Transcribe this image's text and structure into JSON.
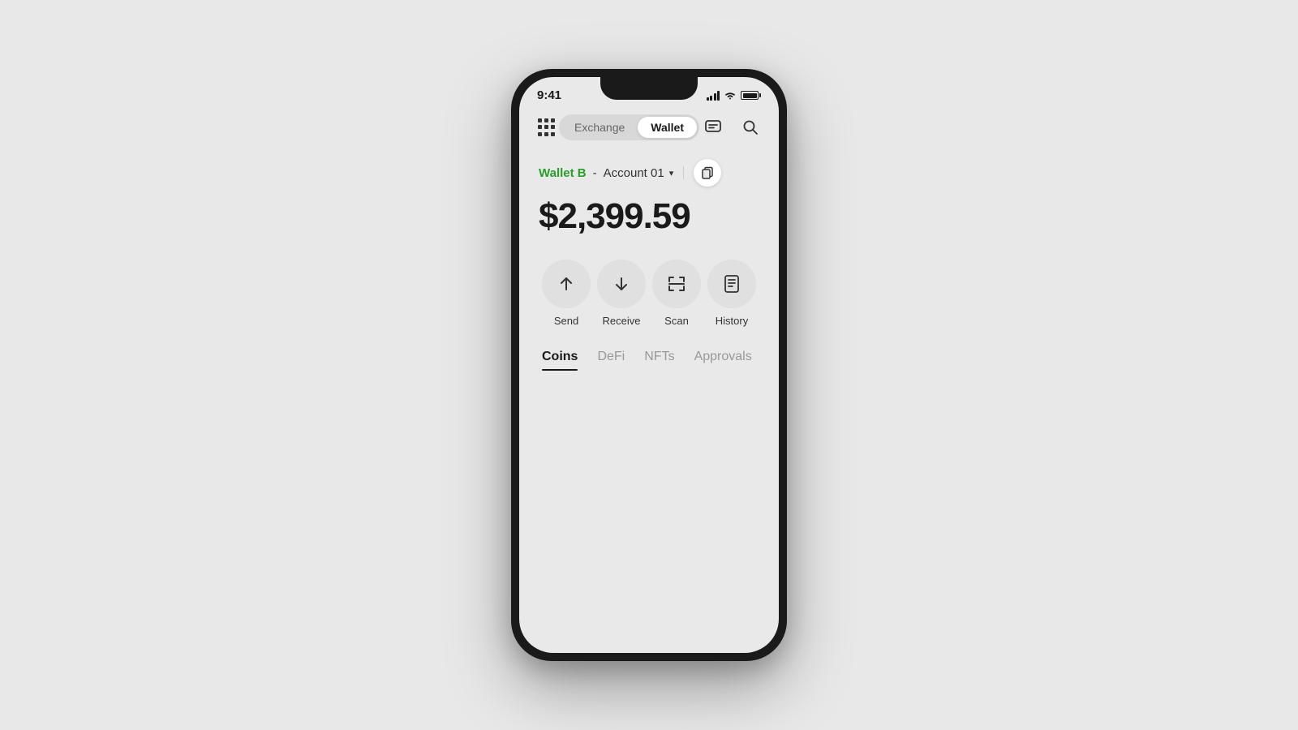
{
  "statusBar": {
    "time": "9:41"
  },
  "header": {
    "exchangeTab": "Exchange",
    "walletTab": "Wallet",
    "activeTab": "wallet"
  },
  "account": {
    "walletName": "Wallet B",
    "separator": "-",
    "accountLabel": "Account 01",
    "chevron": "▾"
  },
  "balance": {
    "amount": "$2,399.59"
  },
  "actions": [
    {
      "id": "send",
      "label": "Send",
      "icon": "arrow-up"
    },
    {
      "id": "receive",
      "label": "Receive",
      "icon": "arrow-down"
    },
    {
      "id": "scan",
      "label": "Scan",
      "icon": "scan"
    },
    {
      "id": "history",
      "label": "History",
      "icon": "history"
    }
  ],
  "tabs": [
    {
      "id": "coins",
      "label": "Coins",
      "active": true
    },
    {
      "id": "defi",
      "label": "DeFi",
      "active": false
    },
    {
      "id": "nfts",
      "label": "NFTs",
      "active": false
    },
    {
      "id": "approvals",
      "label": "Approvals",
      "active": false
    }
  ],
  "colors": {
    "accent": "#2a9d2a",
    "background": "#e9e9e9",
    "text": "#1a1a1a"
  }
}
